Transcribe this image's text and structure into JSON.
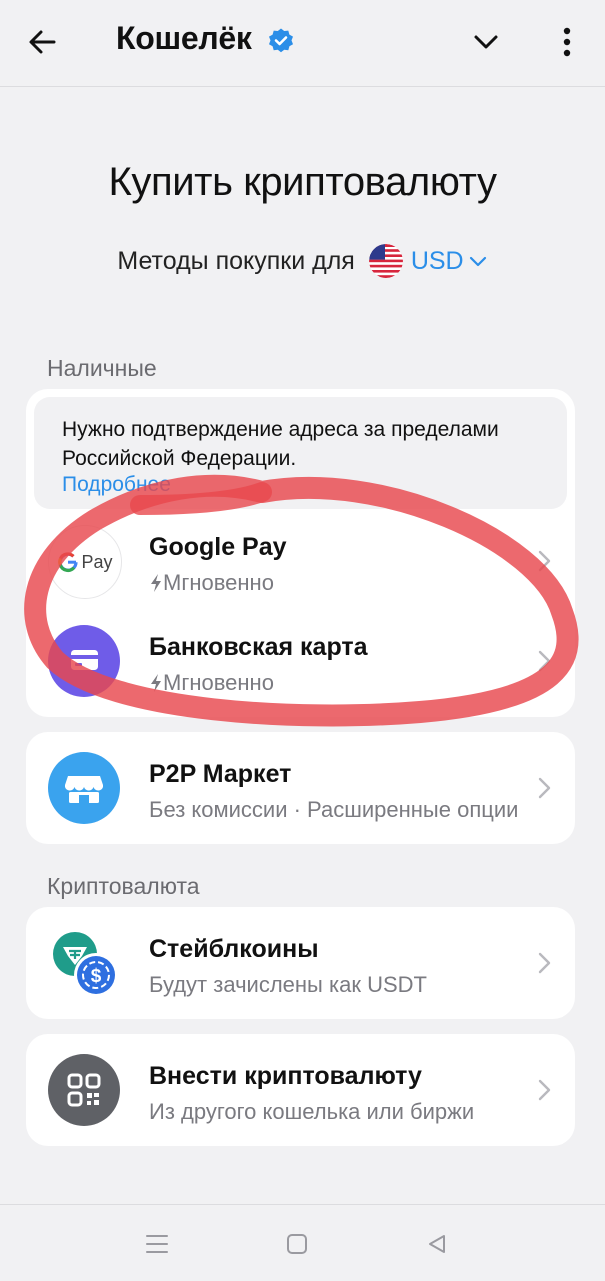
{
  "header": {
    "title": "Кошелёк"
  },
  "hero": {
    "title": "Купить криптовалюту",
    "methods_label": "Методы покупки для",
    "currency": "USD"
  },
  "sections": {
    "cash_label": "Наличные",
    "crypto_label": "Криптовалюта"
  },
  "notice": {
    "text": "Нужно подтверждение адреса за пределами Российской Федерации.",
    "link": "Подробнее"
  },
  "cash_methods": [
    {
      "name": "Google Pay",
      "subtitle": "Мгновенно",
      "icon_label": "Pay"
    },
    {
      "name": "Банковская карта",
      "subtitle": "Мгновенно"
    }
  ],
  "p2p": {
    "name": "P2P Маркет",
    "subtitle": "Без комиссии · Расширенные опции"
  },
  "crypto_methods": [
    {
      "name": "Стейблкоины",
      "subtitle": "Будут зачислены как USDT"
    },
    {
      "name": "Внести криптовалюту",
      "subtitle": "Из другого кошелька или биржи"
    }
  ],
  "colors": {
    "accent": "#2b8ee8",
    "bank_card_icon": "#6f5ce8",
    "p2p_icon": "#3aa3ee",
    "stable_icon": "#1f9c8a",
    "deposit_icon": "#5f6166",
    "marker": "#e8484e"
  }
}
